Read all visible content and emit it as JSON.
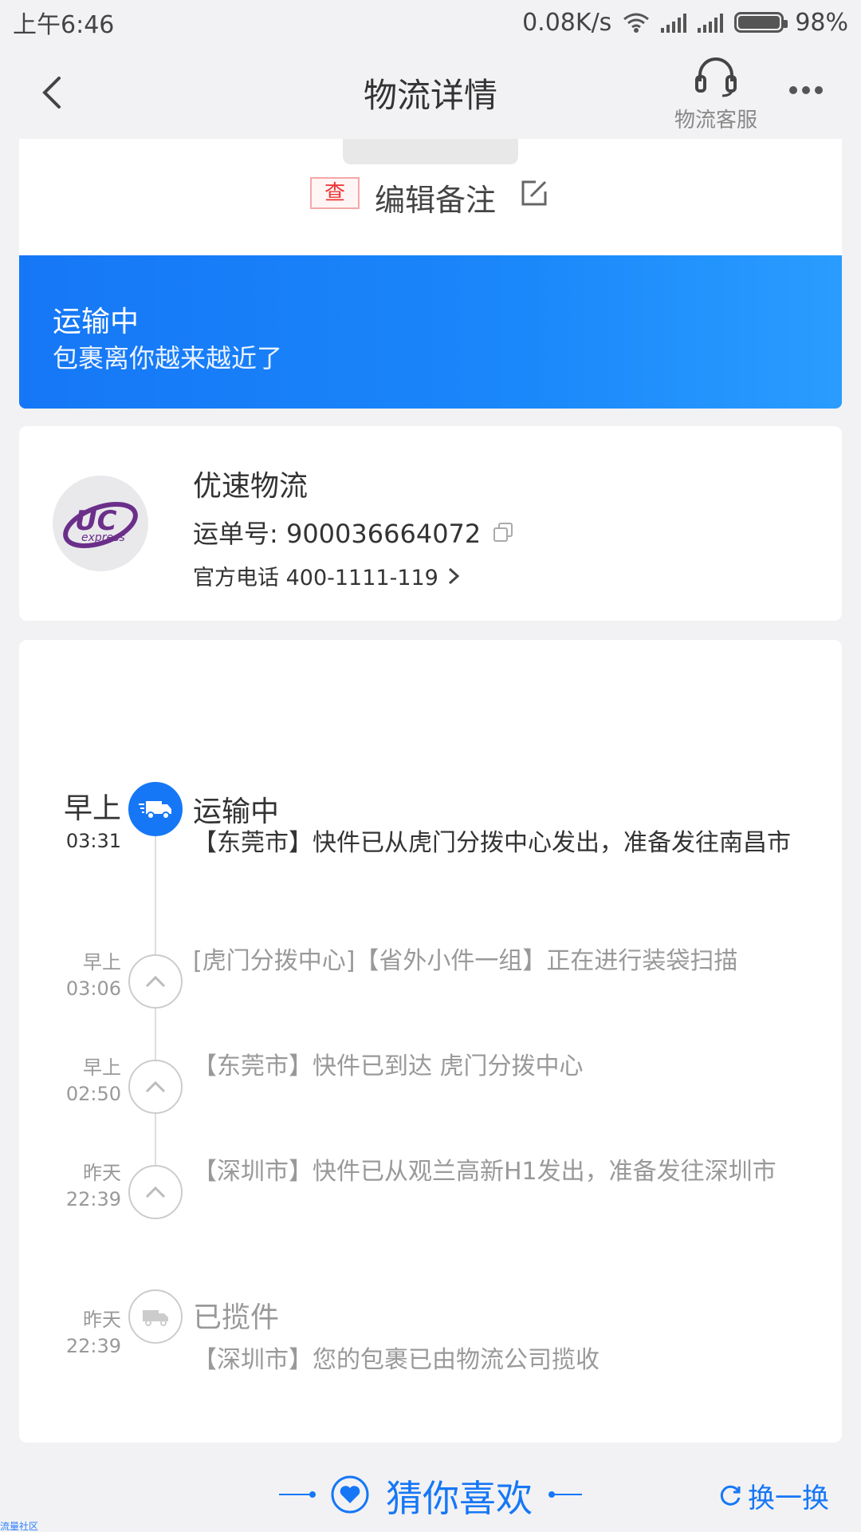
{
  "status_bar": {
    "time": "上午6:46",
    "net_speed": "0.08K/s",
    "battery": "98%"
  },
  "nav": {
    "title": "物流详情",
    "service_label": "物流客服"
  },
  "top_card": {
    "badge": "查",
    "remark_label": "编辑备注"
  },
  "banner": {
    "status": "运输中",
    "subtitle": "包裹离你越来越近了",
    "colors": {
      "start": "#1677f6",
      "end": "#2a9cff"
    }
  },
  "carrier": {
    "name": "优速物流",
    "tracking_label": "运单号: 900036664072",
    "phone_label": "官方电话 400-1111-119",
    "logo_text": "UC",
    "logo_subtext": "express"
  },
  "timeline": [
    {
      "day": "早上",
      "time": "03:31",
      "title": "运输中",
      "desc": "【东莞市】快件已从虎门分拨中心发出，准备发往南昌市",
      "icon": "truck-icon",
      "active": true
    },
    {
      "day": "早上",
      "time": "03:06",
      "desc": "[虎门分拨中心]【省外小件一组】正在进行装袋扫描",
      "icon": "chevron-up-icon"
    },
    {
      "day": "早上",
      "time": "02:50",
      "desc": "【东莞市】快件已到达 虎门分拨中心",
      "icon": "chevron-up-icon"
    },
    {
      "day": "昨天",
      "time": "22:39",
      "desc": "【深圳市】快件已从观兰高新H1发出，准备发往深圳市",
      "icon": "chevron-up-icon"
    },
    {
      "day": "昨天",
      "time": "22:39",
      "title": "已揽件",
      "desc": "【深圳市】您的包裹已由物流公司揽收",
      "icon": "truck-icon"
    }
  ],
  "guess": {
    "label": "猜你喜欢",
    "refresh_label": "换一换"
  },
  "watermark": "流量社区",
  "accent_color": "#1677f6"
}
